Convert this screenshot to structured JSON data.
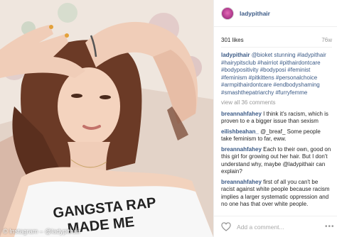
{
  "photo": {
    "credit": "© Instagram – @ladypithair",
    "shirt_text_line1": "GANGSTA RAP",
    "shirt_text_line2": "MADE ME"
  },
  "post": {
    "username": "ladypithair",
    "likes": "301 likes",
    "time": "76w",
    "caption_user": "ladypithair",
    "caption_text": "@bioket stunning #ladypithair #hairypitsclub #hairriot #pithairdontcare #bodypositivity #bodyposi #feminist #feminism #pitkittens #personalchoice #armpithairdontcare #endbodyshaming #smashthepatriarchy #furryfemme",
    "view_all": "view all 36 comments",
    "comments": [
      {
        "user": "breannahfahey",
        "text": "I think it's racism, which is proven to e a bigger issue than sexism"
      },
      {
        "user": "eilishbeahan_",
        "text": "@_breaf_ Some people take feminism to far, eww."
      },
      {
        "user": "breannahfahey",
        "text": "Each to their own, good on this girl for growing out her hair. But I don't understand why, maybe @ladypithair can explain?"
      },
      {
        "user": "breannahfahey",
        "text": "first of all you can't be racist against white people because racism implies a larger systematic oppression and no one has that over white people."
      }
    ],
    "add_comment_placeholder": "Add a comment...",
    "more_label": "•••"
  },
  "colors": {
    "link": "#3b5a86",
    "muted": "#999999"
  },
  "icons": {
    "like": "heart-outline-icon",
    "options": "more-options-icon"
  }
}
